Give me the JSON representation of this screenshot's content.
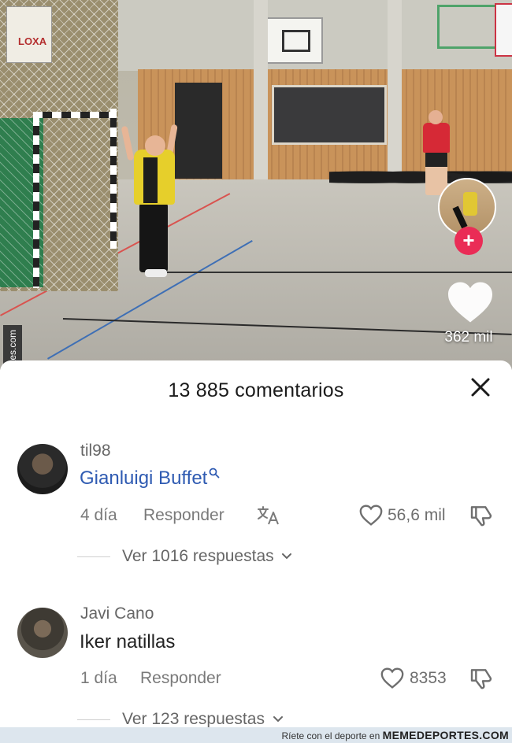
{
  "video": {
    "banner_text": "LOXA",
    "like_count": "362 mil",
    "follow_symbol": "+",
    "side_watermark": "Memedeportes.com"
  },
  "comments_sheet": {
    "title": "13 885 comentarios",
    "comments": [
      {
        "username": "til98",
        "text": "Gianluigi Buffet",
        "time": "4 día",
        "reply_label": "Responder",
        "translate_icon": "translate-icon",
        "likes": "56,6 mil",
        "replies": "Ver 1016 respuestas"
      },
      {
        "username": "Javi Cano",
        "text": "Iker natillas",
        "time": "1 día",
        "reply_label": "Responder",
        "likes": "8353",
        "replies": "Ver 123 respuestas"
      }
    ]
  },
  "footer": {
    "tagline": "Ríete con el deporte en",
    "brand": "MEMEDEPORTES.COM"
  },
  "colors": {
    "link": "#2f5bb2",
    "follow": "#ea2c56",
    "text_muted": "#7a7a7a"
  }
}
